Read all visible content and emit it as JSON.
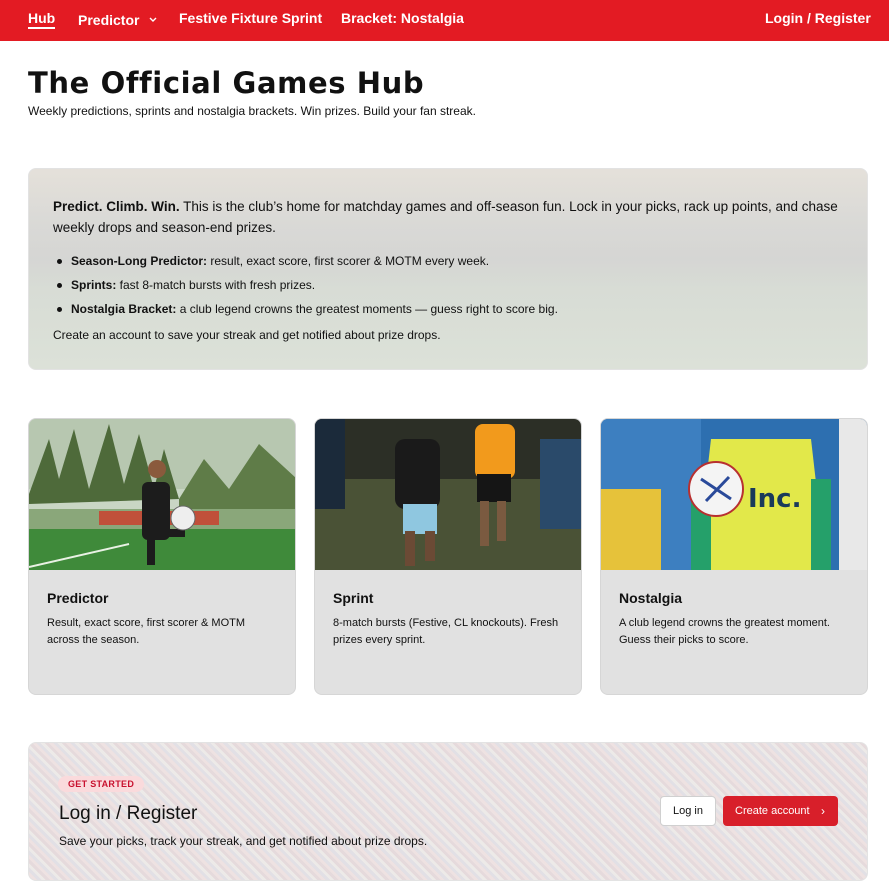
{
  "nav": {
    "items": [
      {
        "label": "Hub",
        "active": true
      },
      {
        "label": "Predictor",
        "has_dropdown": true
      },
      {
        "label": "Festive Fixture Sprint"
      },
      {
        "label": "Bracket: Nostalgia"
      }
    ],
    "auth_label": "Login / Register",
    "color": "#e31b23"
  },
  "header": {
    "title": "The Official Games Hub",
    "subtitle": "Weekly predictions, sprints and nostalgia brackets. Win prizes. Build your fan streak."
  },
  "intro": {
    "lead_bold": "Predict. Climb. Win.",
    "lead_text": " This is the club’s home for matchday games and off-season fun. Lock in your picks, rack up points, and chase weekly drops and season-end prizes.",
    "bullets": [
      {
        "bold": "Season-Long Predictor:",
        "text": " result, exact score, first scorer & MOTM every week."
      },
      {
        "bold": "Sprints:",
        "text": " fast 8-match bursts with fresh prizes."
      },
      {
        "bold": "Nostalgia Bracket:",
        "text": " a club legend crowns the greatest moments — guess right to score big."
      }
    ],
    "footer": "Create an account to save your streak and get notified about prize drops."
  },
  "cards": [
    {
      "title": "Predictor",
      "description": "Result, exact score, first scorer & MOTM across the season."
    },
    {
      "title": "Sprint",
      "description": "8-match bursts (Festive, CL knockouts). Fresh prizes every sprint."
    },
    {
      "title": "Nostalgia",
      "description": "A club legend crowns the greatest moment. Guess their picks to score.",
      "kit_text": "Inc."
    }
  ],
  "cta": {
    "badge": "GET STARTED",
    "title": "Log in / Register",
    "subtitle": "Save your picks, track your streak, and get notified about prize drops.",
    "login_label": "Log in",
    "create_label": "Create account",
    "accent": "#d81f2a"
  }
}
